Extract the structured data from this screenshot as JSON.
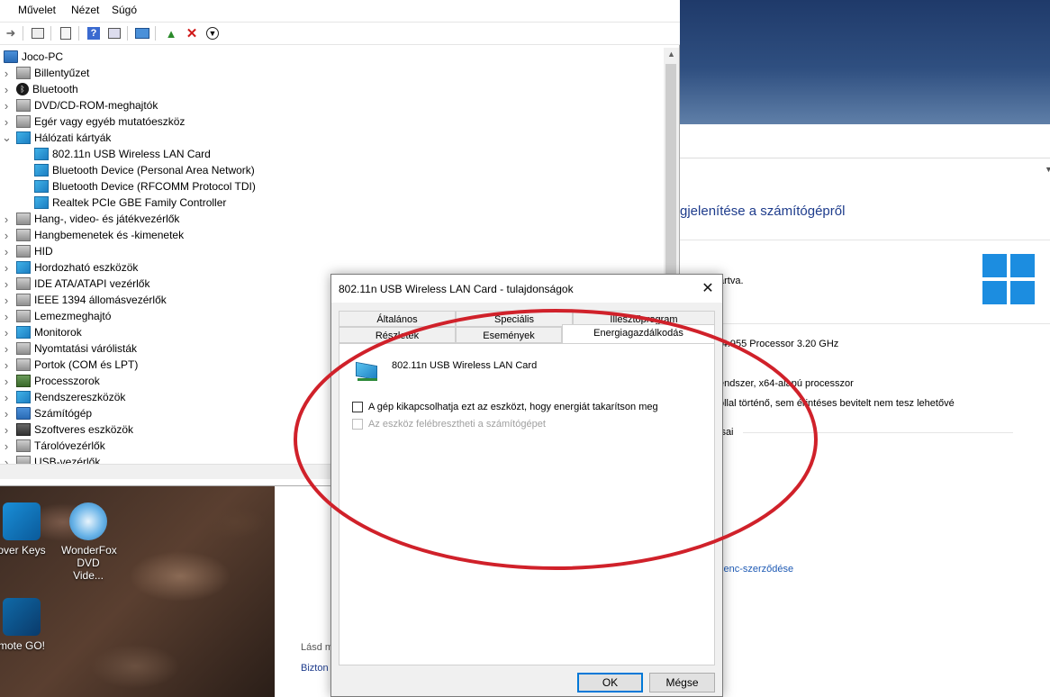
{
  "menubar": {
    "items": [
      "Művelet",
      "Nézet",
      "Súgó"
    ]
  },
  "toolbar": {
    "icons": [
      "forward-icon",
      "properties-icon",
      "list-icon",
      "help-icon",
      "view-icon",
      "monitor-icon",
      "add-driver-icon",
      "uninstall-icon",
      "download-icon"
    ]
  },
  "tree": {
    "root": "Joco-PC",
    "items": [
      {
        "label": "Billentyűzet",
        "icon": "keyboard-icon",
        "expanded": false
      },
      {
        "label": "Bluetooth",
        "icon": "bluetooth-icon",
        "expanded": false
      },
      {
        "label": "DVD/CD-ROM-meghajtók",
        "icon": "dvd-icon",
        "expanded": false
      },
      {
        "label": "Egér vagy egyéb mutatóeszköz",
        "icon": "mouse-icon",
        "expanded": false
      },
      {
        "label": "Hálózati kártyák",
        "icon": "network-icon",
        "expanded": true
      },
      {
        "label": "802.11n USB Wireless LAN Card",
        "icon": "network-icon",
        "child": true
      },
      {
        "label": "Bluetooth Device (Personal Area Network)",
        "icon": "network-icon",
        "child": true
      },
      {
        "label": "Bluetooth Device (RFCOMM Protocol TDI)",
        "icon": "network-icon",
        "child": true
      },
      {
        "label": "Realtek PCIe GBE Family Controller",
        "icon": "network-icon",
        "child": true
      },
      {
        "label": "Hang-, video- és játékvezérlők",
        "icon": "speaker-icon",
        "expanded": false
      },
      {
        "label": "Hangbemenetek és -kimenetek",
        "icon": "speaker-icon",
        "expanded": false
      },
      {
        "label": "HID",
        "icon": "hid-icon",
        "expanded": false
      },
      {
        "label": "Hordozható eszközök",
        "icon": "portable-icon",
        "expanded": false
      },
      {
        "label": "IDE ATA/ATAPI vezérlők",
        "icon": "ide-icon",
        "expanded": false
      },
      {
        "label": "IEEE 1394 állomásvezérlők",
        "icon": "ieee-icon",
        "expanded": false
      },
      {
        "label": "Lemezmeghajtó",
        "icon": "disk-icon",
        "expanded": false
      },
      {
        "label": "Monitorok",
        "icon": "monitor-icon",
        "expanded": false
      },
      {
        "label": "Nyomtatási várólisták",
        "icon": "printer-icon",
        "expanded": false
      },
      {
        "label": "Portok (COM és LPT)",
        "icon": "port-icon",
        "expanded": false
      },
      {
        "label": "Processzorok",
        "icon": "cpu-icon",
        "expanded": false
      },
      {
        "label": "Rendszereszközök",
        "icon": "system-icon",
        "expanded": false
      },
      {
        "label": "Számítógép",
        "icon": "computer-icon",
        "expanded": false
      },
      {
        "label": "Szoftveres eszközök",
        "icon": "software-icon",
        "expanded": false
      },
      {
        "label": "Tárolóvezérlők",
        "icon": "storage-icon",
        "expanded": false
      },
      {
        "label": "USB-vezérlők",
        "icon": "usb-icon",
        "expanded": false
      }
    ]
  },
  "desktop": {
    "icons": [
      {
        "label": "over Keys",
        "icon": "recover-keys-icon"
      },
      {
        "label": "WonderFox DVD Vide...",
        "icon": "wonderfox-icon"
      },
      {
        "label": "mote GO!",
        "icon": "remote-go-icon"
      }
    ]
  },
  "system": {
    "heading": "gjelenítése a számítógépről",
    "edition": "artva.",
    "processor": "(4.955 Processor   3.20 GHz",
    "type": "endszer, x64-alapú processzor",
    "pen": "ollal történő, sem érintéses bevitelt nem tesz lehetővé",
    "settings": "isai",
    "license": "cenc-szerződése",
    "see_also": "Lásd m",
    "security": "Bizton"
  },
  "dialog": {
    "title": "802.11n USB Wireless LAN Card - tulajdonságok",
    "tabs_row1": [
      "Általános",
      "Speciális",
      "Illesztőprogram"
    ],
    "tabs_row2": [
      "Részletek",
      "Események",
      "Energiagazdálkodás"
    ],
    "active_tab": "Energiagazdálkodás",
    "device_name": "802.11n USB Wireless LAN Card",
    "option_allow_off": "A gép kikapcsolhatja ezt az eszközt, hogy energiát takarítson meg",
    "option_allow_off_checked": false,
    "option_wake": "Az eszköz felébresztheti a számítógépet",
    "option_wake_checked": false,
    "option_wake_enabled": false,
    "ok_label": "OK",
    "cancel_label": "Mégse"
  },
  "colors": {
    "annotation": "#d0212a",
    "accent": "#0078d7",
    "windows_logo": "#1c8de0"
  }
}
